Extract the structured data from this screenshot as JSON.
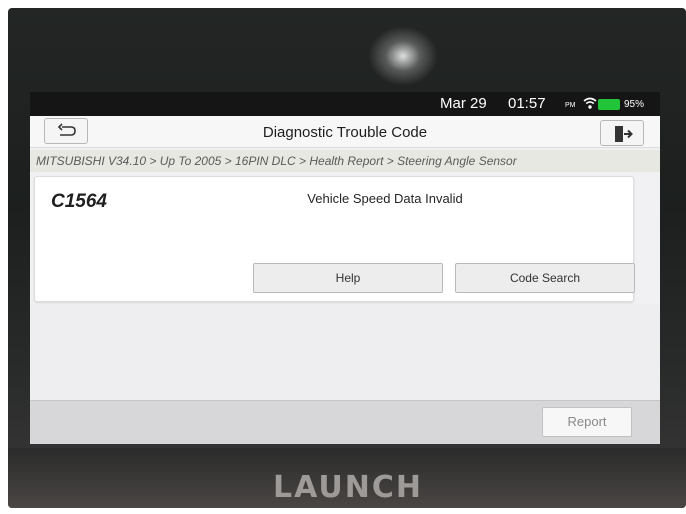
{
  "status_bar": {
    "date": "Mar 29",
    "time": "01:57",
    "ampm": "PM",
    "battery": "95%",
    "wifi_icon": "wifi-icon",
    "battery_icon": "battery-icon"
  },
  "header": {
    "title": "Diagnostic Trouble Code",
    "back_icon": "back-arrow-icon",
    "exit_icon": "exit-icon"
  },
  "breadcrumb": "MITSUBISHI V34.10 > Up To 2005 > 16PIN DLC > Health Report > Steering Angle Sensor",
  "dtc": {
    "code": "C1564",
    "description": "Vehicle Speed Data Invalid",
    "help_label": "Help",
    "code_search_label": "Code Search"
  },
  "footer": {
    "report_label": "Report"
  },
  "device": {
    "brand": "LAUNCH"
  },
  "colors": {
    "battery": "#22c53a",
    "title_text": "#1e1e1e",
    "breadcrumb_bg": "#e8e8e2"
  }
}
